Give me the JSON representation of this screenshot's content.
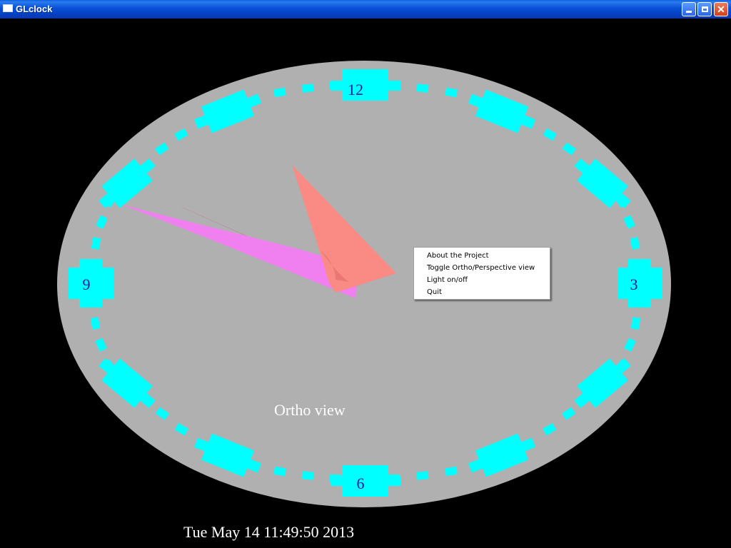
{
  "window": {
    "title": "GLclock"
  },
  "clock": {
    "numerals": {
      "twelve": "12",
      "three": "3",
      "six": "6",
      "nine": "9"
    },
    "view_label": "Ortho view",
    "datetime": "Tue May 14 11:49:50 2013",
    "colors": {
      "face": "#b0b0b0",
      "markers": "#00ffff",
      "numerals": "#1a1aa0",
      "hour_hand": "#fa8a84",
      "minute_hand": "#f080f0",
      "second_hand": "#ee0a8a"
    }
  },
  "context_menu": {
    "items": [
      {
        "label": "About the Project"
      },
      {
        "label": "Toggle Ortho/Perspective view"
      },
      {
        "label": "Light on/off"
      },
      {
        "label": "Quit"
      }
    ]
  }
}
